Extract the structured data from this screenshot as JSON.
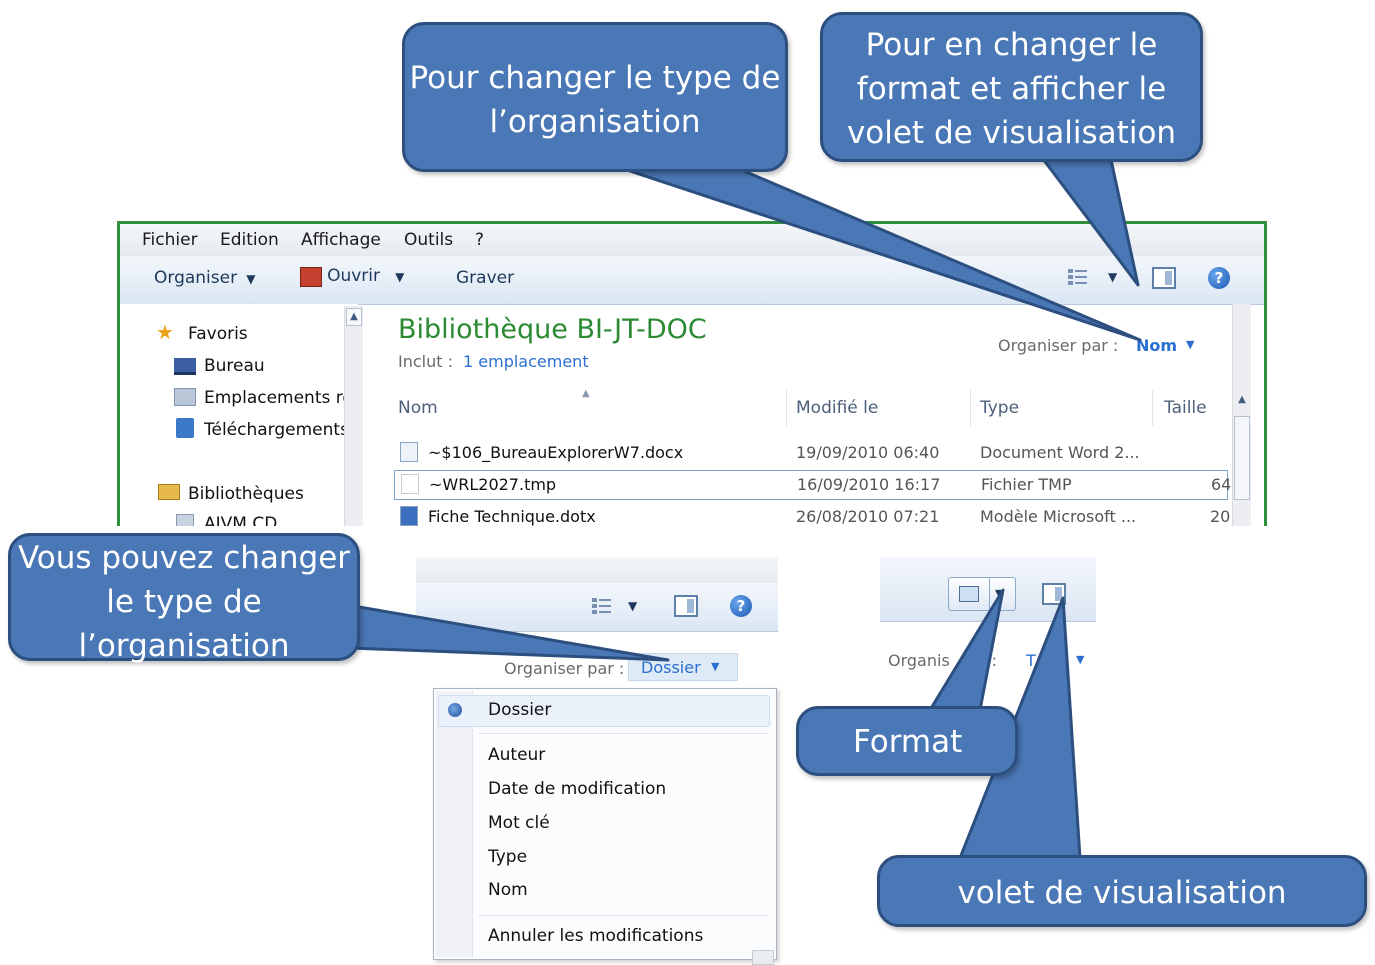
{
  "menubar": {
    "items": [
      "Fichier",
      "Edition",
      "Affichage",
      "Outils",
      "?"
    ]
  },
  "toolbar": {
    "organize": "Organiser",
    "open": "Ouvrir",
    "burn": "Graver",
    "help": "?"
  },
  "navigation": {
    "favorites": "Favoris",
    "items": [
      "Bureau",
      "Emplacements ré",
      "Téléchargements"
    ],
    "libraries": "Bibliothèques",
    "partial": "AIVM CD"
  },
  "library": {
    "title": "Bibliothèque BI-JT-DOC",
    "includes_label": "Inclut :",
    "includes_link": "1 emplacement",
    "arrange_label": "Organiser par :",
    "arrange_value": "Nom"
  },
  "file_list": {
    "columns": [
      "Nom",
      "Modifié le",
      "Type",
      "Taille"
    ],
    "rows": [
      {
        "name": "~$106_BureauExplorerW7.docx",
        "modified": "19/09/2010 06:40",
        "type": "Document Word 2...",
        "size": ""
      },
      {
        "name": "~WRL2027.tmp",
        "modified": "16/09/2010 16:17",
        "type": "Fichier TMP",
        "size": "64"
      },
      {
        "name": "Fiche Technique.dotx",
        "modified": "26/08/2010 07:21",
        "type": "Modèle Microsoft ...",
        "size": "20"
      }
    ]
  },
  "arrange_panel": {
    "label": "Organiser par :",
    "value": "Dossier",
    "options": [
      "Dossier",
      "Auteur",
      "Date de modification",
      "Mot clé",
      "Type",
      "Nom"
    ],
    "reset": "Annuler les modifications"
  },
  "format_panel": {
    "partial_label": "Organis",
    "partial_colon": "r :",
    "partial_value": "T"
  },
  "callouts": {
    "organize_type": "Pour changer le type de l’organisation",
    "format_preview": "Pour en changer le format et afficher le volet de visualisation",
    "can_change": "Vous pouvez changer le type de l’organisation",
    "format": "Format",
    "preview_pane": "volet de visualisation"
  },
  "colors": {
    "callout_fill": "#4a78b6",
    "callout_border": "#2c4f80",
    "title_green": "#2b8a32",
    "link_blue": "#2a6fd1"
  },
  "icons": [
    "star-icon",
    "desktop-icon",
    "places-icon",
    "downloads-icon",
    "libraries-icon",
    "open-icon",
    "views-icon",
    "preview-pane-icon",
    "help-icon",
    "radio-selected-icon"
  ]
}
